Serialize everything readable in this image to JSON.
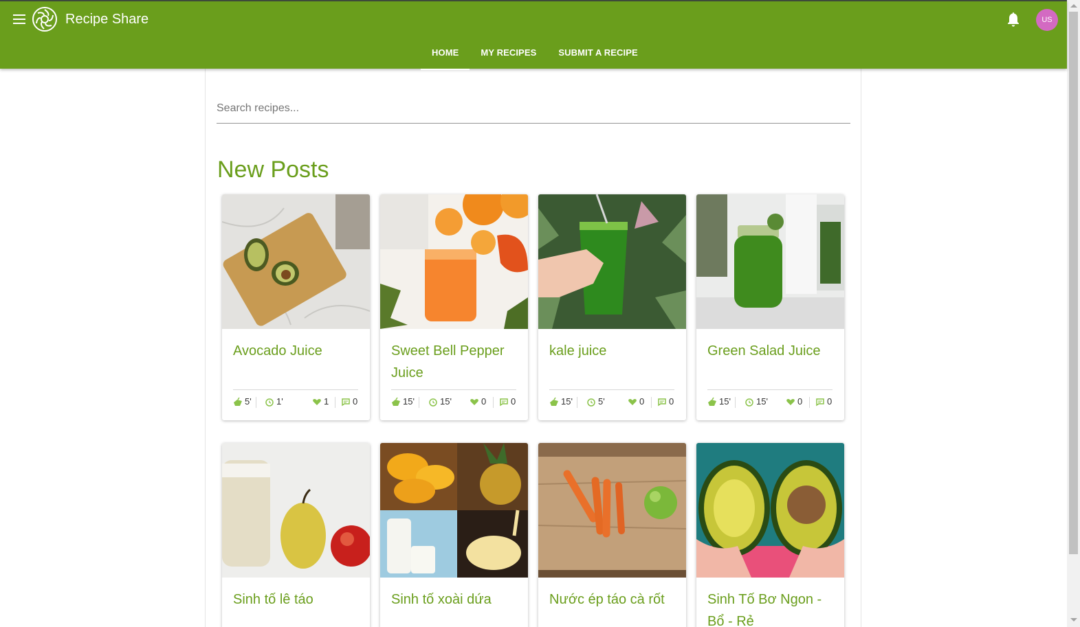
{
  "app": {
    "title": "Recipe Share",
    "user_initials": "US",
    "colors": {
      "primary": "#6a9e1c",
      "avatar": "#d36ac2",
      "stat_icon": "#8bc34a"
    }
  },
  "nav": {
    "tabs": [
      {
        "label": "HOME",
        "active": true
      },
      {
        "label": "MY RECIPES",
        "active": false
      },
      {
        "label": "SUBMIT A RECIPE",
        "active": false
      }
    ]
  },
  "search": {
    "placeholder": "Search recipes..."
  },
  "section": {
    "title": "New Posts"
  },
  "cards": [
    {
      "title": "Avocado Juice",
      "prep": "5'",
      "cook": "1'",
      "likes": "1",
      "comments": "0",
      "image": "avocado-on-cutting-board"
    },
    {
      "title": "Sweet Bell Pepper Juice",
      "prep": "15'",
      "cook": "15'",
      "likes": "0",
      "comments": "0",
      "image": "orange-juice-glass"
    },
    {
      "title": "kale juice",
      "prep": "15'",
      "cook": "5'",
      "likes": "0",
      "comments": "0",
      "image": "green-juice-hand"
    },
    {
      "title": "Green Salad Juice",
      "prep": "15'",
      "cook": "15'",
      "likes": "0",
      "comments": "0",
      "image": "green-juice-jar"
    },
    {
      "title": "Sinh tố lê táo",
      "image": "pear-apple-smoothie"
    },
    {
      "title": "Sinh tố xoài dứa",
      "image": "mango-pineapple-collage"
    },
    {
      "title": "Nước ép táo cà rốt",
      "image": "carrots-apple-board"
    },
    {
      "title": "Sinh Tố Bơ Ngon - Bổ - Rẻ",
      "image": "avocado-halves-hands"
    }
  ]
}
